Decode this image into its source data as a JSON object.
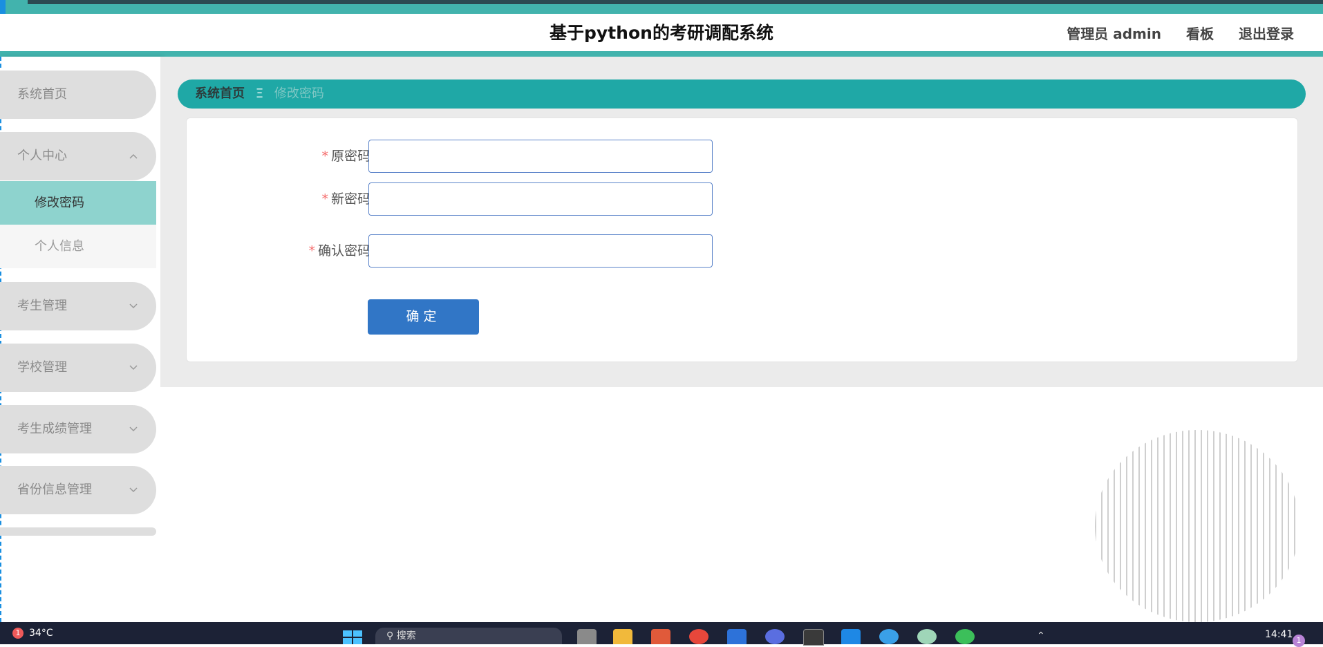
{
  "header": {
    "title": "基于python的考研调配系统",
    "user_label": "管理员 admin",
    "board_link": "看板",
    "logout_link": "退出登录"
  },
  "sidebar": {
    "items": [
      {
        "label": "系统首页",
        "expanded": false
      },
      {
        "label": "个人中心",
        "expanded": true,
        "icon": "chevron-up-icon",
        "children": [
          {
            "label": "修改密码",
            "active": true
          },
          {
            "label": "个人信息",
            "active": false
          }
        ]
      },
      {
        "label": "考生管理",
        "icon": "chevron-down-icon"
      },
      {
        "label": "学校管理",
        "icon": "chevron-down-icon"
      },
      {
        "label": "考生成绩管理",
        "icon": "chevron-down-icon"
      },
      {
        "label": "省份信息管理",
        "icon": "chevron-down-icon"
      }
    ]
  },
  "breadcrumb": {
    "home": "系统首页",
    "separator": "Ξ",
    "current": "修改密码"
  },
  "form": {
    "required_mark": "*",
    "fields": [
      {
        "label": "原密码",
        "value": ""
      },
      {
        "label": "新密码",
        "value": ""
      },
      {
        "label": "确认密码",
        "value": ""
      }
    ],
    "submit_label": "确定"
  },
  "taskbar": {
    "weather_badge": "1",
    "temperature": "34°C",
    "search_placeholder": "搜索",
    "time": "14:41",
    "notification_count": "1"
  },
  "colors": {
    "accent_teal": "#42b3ad",
    "breadcrumb_bg": "#1fa8a6",
    "active_menu": "#8ed3ce",
    "primary_button": "#3176c6",
    "required_star": "#f56c6c"
  }
}
